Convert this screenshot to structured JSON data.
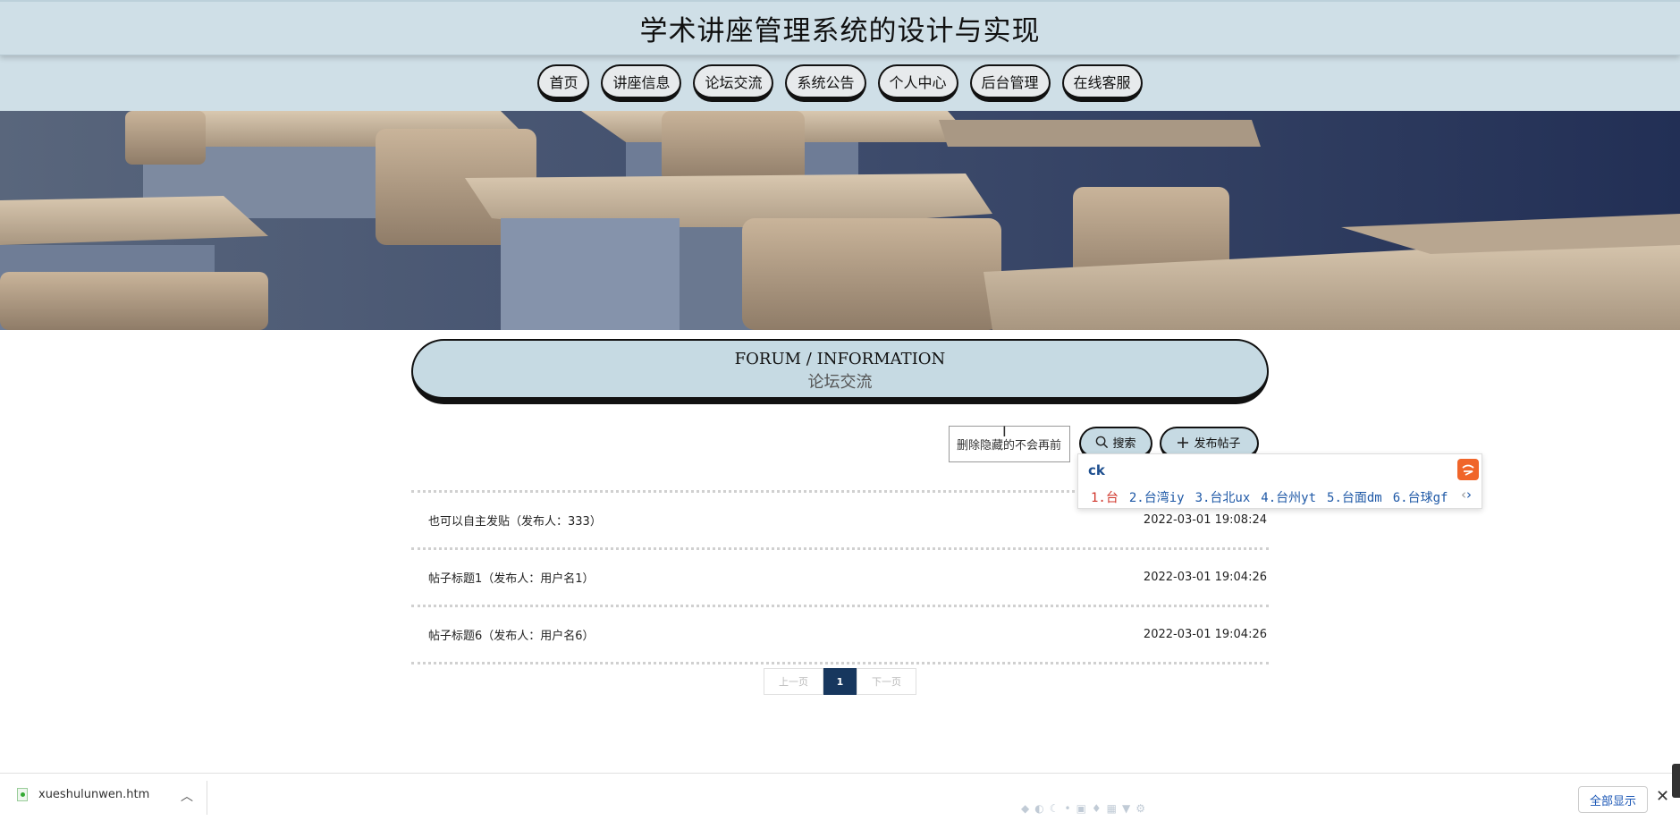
{
  "header": {
    "title": "学术讲座管理系统的设计与实现"
  },
  "nav": {
    "items": [
      "首页",
      "讲座信息",
      "论坛交流",
      "系统公告",
      "个人中心",
      "后台管理",
      "在线客服"
    ]
  },
  "section": {
    "title_en": "FORUM / INFORMATION",
    "title_cn": "论坛交流"
  },
  "search": {
    "value": "删除隐藏的不会再前",
    "search_label": "搜索",
    "publish_label": "发布帖子"
  },
  "ime": {
    "composition": "ck",
    "candidates": [
      "1.台",
      "2.台湾iy",
      "3.台北ux",
      "4.台州yt",
      "5.台面dm",
      "6.台球gf"
    ]
  },
  "posts": [
    {
      "title": "也可以自主发贴（发布人：333）",
      "time": "2022-03-01 19:08:24"
    },
    {
      "title": "帖子标题1（发布人：用户名1）",
      "time": "2022-03-01 19:04:26"
    },
    {
      "title": "帖子标题6（发布人：用户名6）",
      "time": "2022-03-01 19:04:26"
    }
  ],
  "pagination": {
    "prev": "上一页",
    "current": "1",
    "next": "下一页"
  },
  "download_bar": {
    "filename": "xueshulunwen.htm",
    "show_all": "全部显示",
    "close": "✕"
  },
  "colors": {
    "header_bg": "#cfdfe7",
    "section_bg": "#c6dae3",
    "page_active": "#17375e",
    "ime_accent": "#f0652a"
  }
}
